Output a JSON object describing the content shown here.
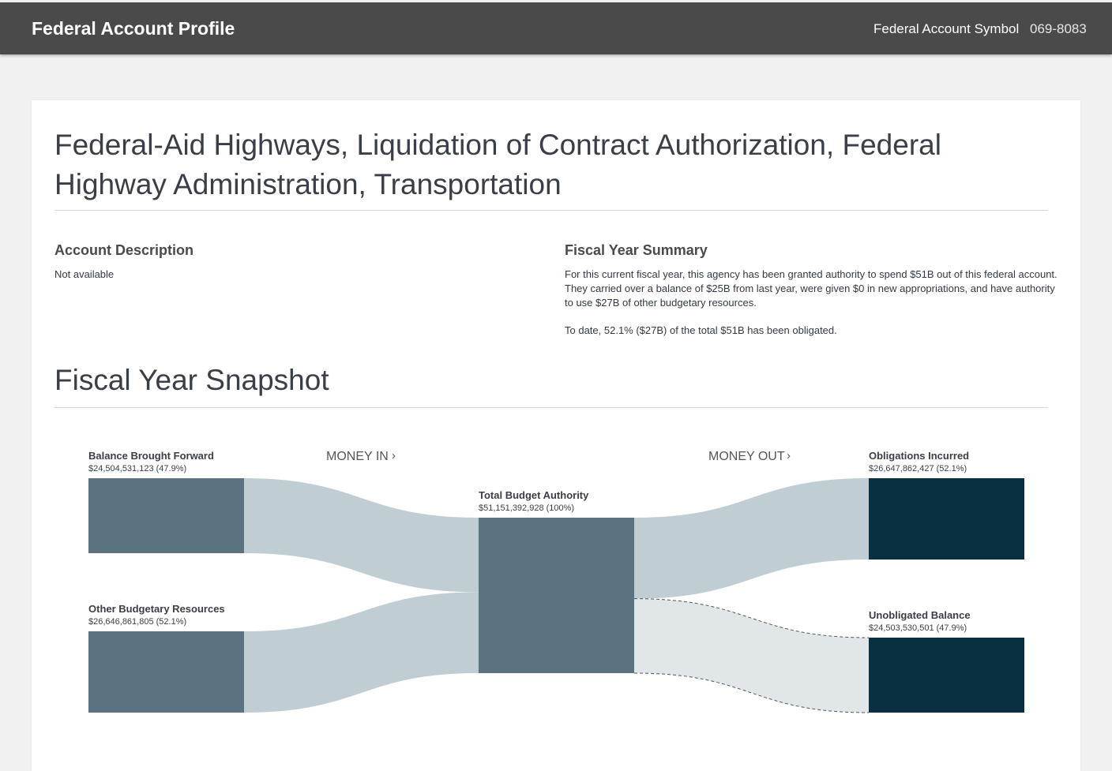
{
  "header": {
    "title": "Federal Account Profile",
    "symbol_label": "Federal Account Symbol",
    "symbol_value": "069-8083"
  },
  "account": {
    "title": "Federal-Aid Highways, Liquidation of Contract Authorization, Federal Highway Administration, Transportation"
  },
  "description": {
    "heading": "Account Description",
    "text": "Not available"
  },
  "fiscal_summary": {
    "heading": "Fiscal Year Summary",
    "paragraph1": "For this current fiscal year, this agency has been granted authority to spend $51B out of this federal account. They carried over a balance of $25B from last year, were given $0 in new appropriations, and have authority to use $27B of other budgetary resources.",
    "paragraph2": "To date, 52.1% ($27B) of the total $51B has been obligated."
  },
  "snapshot": {
    "heading": "Fiscal Year Snapshot",
    "money_in_label": "MONEY IN",
    "money_out_label": "MONEY OUT",
    "arrow_glyph": "›"
  },
  "colors": {
    "resource": "#5b7380",
    "obligation": "#083041",
    "flow": "#c0ced3",
    "flow_unobligated": "#e1e6e8"
  },
  "chart_data": {
    "type": "sankey",
    "nodes": [
      {
        "id": "bbf",
        "name": "Balance Brought Forward",
        "value_text": "$24,504,531,123 (47.9%)",
        "value": 24504531123
      },
      {
        "id": "obr",
        "name": "Other Budgetary Resources",
        "value_text": "$26,646,861,805 (52.1%)",
        "value": 26646861805
      },
      {
        "id": "tba",
        "name": "Total Budget Authority",
        "value_text": "$51,151,392,928 (100%)",
        "value": 51151392928
      },
      {
        "id": "obl",
        "name": "Obligations Incurred",
        "value_text": "$26,647,862,427 (52.1%)",
        "value": 26647862427
      },
      {
        "id": "unob",
        "name": "Unobligated Balance",
        "value_text": "$24,503,530,501 (47.9%)",
        "value": 24503530501
      }
    ],
    "links": [
      {
        "source": "bbf",
        "target": "tba",
        "value": 24504531123
      },
      {
        "source": "obr",
        "target": "tba",
        "value": 26646861805
      },
      {
        "source": "tba",
        "target": "obl",
        "value": 26647862427
      },
      {
        "source": "tba",
        "target": "unob",
        "value": 24503530501,
        "style": "dashed"
      }
    ]
  }
}
